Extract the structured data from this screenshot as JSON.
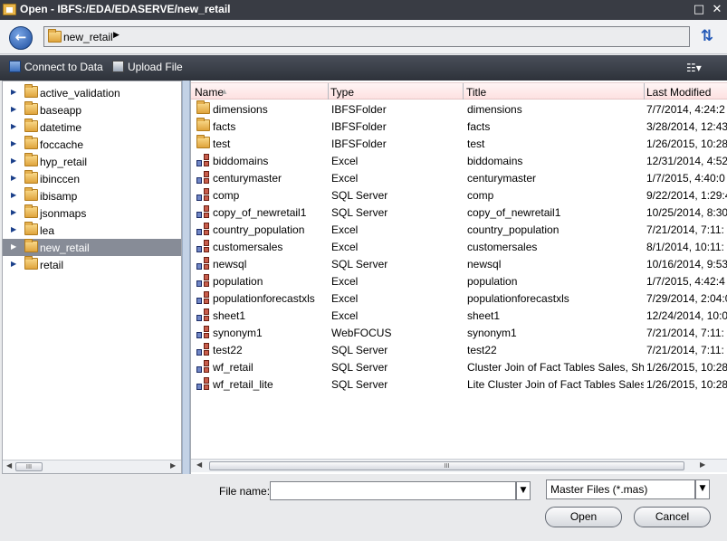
{
  "window": {
    "title": "Open - IBFS:/EDA/EDASERVE/new_retail",
    "maximize_glyph": "□",
    "close_glyph": "✕"
  },
  "nav": {
    "back_glyph": "←",
    "path_label": "new_retail",
    "path_arrow": "▶",
    "refresh_glyph": "⇅"
  },
  "toolbar": {
    "connect_label": "Connect to Data",
    "upload_label": "Upload File",
    "view_glyph": "☷▾"
  },
  "tree": {
    "expand_glyph": "▶",
    "items": [
      {
        "label": "active_validation"
      },
      {
        "label": "baseapp"
      },
      {
        "label": "datetime"
      },
      {
        "label": "foccache"
      },
      {
        "label": "hyp_retail"
      },
      {
        "label": "ibinccen"
      },
      {
        "label": "ibisamp"
      },
      {
        "label": "jsonmaps"
      },
      {
        "label": "lea"
      },
      {
        "label": "new_retail",
        "selected": true
      },
      {
        "label": "retail"
      }
    ]
  },
  "list": {
    "columns": {
      "name": "Name",
      "type": "Type",
      "title": "Title",
      "modified": "Last Modified"
    },
    "sort_glyph": "▲",
    "rows": [
      {
        "icon": "folder",
        "name": "dimensions",
        "type": "IBFSFolder",
        "title": "dimensions",
        "modified": "7/7/2014, 4:24:2"
      },
      {
        "icon": "folder",
        "name": "facts",
        "type": "IBFSFolder",
        "title": "facts",
        "modified": "3/28/2014, 12:43"
      },
      {
        "icon": "folder",
        "name": "test",
        "type": "IBFSFolder",
        "title": "test",
        "modified": "1/26/2015, 10:28"
      },
      {
        "icon": "synonym",
        "name": "biddomains",
        "type": "Excel",
        "title": "biddomains",
        "modified": "12/31/2014, 4:52"
      },
      {
        "icon": "synonym",
        "name": "centurymaster",
        "type": "Excel",
        "title": "centurymaster",
        "modified": "1/7/2015, 4:40:0"
      },
      {
        "icon": "synonym",
        "name": "comp",
        "type": "SQL Server",
        "title": "comp",
        "modified": "9/22/2014, 1:29:4"
      },
      {
        "icon": "synonym",
        "name": "copy_of_newretail1",
        "type": "SQL Server",
        "title": "copy_of_newretail1",
        "modified": "10/25/2014, 8:30"
      },
      {
        "icon": "synonym",
        "name": "country_population",
        "type": "Excel",
        "title": "country_population",
        "modified": "7/21/2014, 7:11:"
      },
      {
        "icon": "synonym",
        "name": "customersales",
        "type": "Excel",
        "title": "customersales",
        "modified": "8/1/2014, 10:11:"
      },
      {
        "icon": "synonym",
        "name": "newsql",
        "type": "SQL Server",
        "title": "newsql",
        "modified": "10/16/2014, 9:53"
      },
      {
        "icon": "synonym",
        "name": "population",
        "type": "Excel",
        "title": "population",
        "modified": "1/7/2015, 4:42:4"
      },
      {
        "icon": "synonym",
        "name": "populationforecastxls",
        "type": "Excel",
        "title": "populationforecastxls",
        "modified": "7/29/2014, 2:04:0"
      },
      {
        "icon": "synonym",
        "name": "sheet1",
        "type": "Excel",
        "title": "sheet1",
        "modified": "12/24/2014, 10:0"
      },
      {
        "icon": "synonym",
        "name": "synonym1",
        "type": "WebFOCUS",
        "title": "synonym1",
        "modified": "7/21/2014, 7:11:"
      },
      {
        "icon": "synonym",
        "name": "test22",
        "type": "SQL Server",
        "title": "test22",
        "modified": "7/21/2014, 7:11:"
      },
      {
        "icon": "synonym",
        "name": "wf_retail",
        "type": "SQL Server",
        "title": "Cluster Join of Fact Tables Sales, Shipme",
        "modified": "1/26/2015, 10:28"
      },
      {
        "icon": "synonym",
        "name": "wf_retail_lite",
        "type": "SQL Server",
        "title": "Lite Cluster Join of Fact Tables Sales and",
        "modified": "1/26/2015, 10:28"
      }
    ]
  },
  "scroll": {
    "left_glyph": "◀",
    "right_glyph": "▶",
    "thumb_glyph": "III"
  },
  "footer": {
    "file_name_label": "File name:",
    "file_name_value": "",
    "dropdown_glyph": "▼",
    "filter_value": "Master Files (*.mas)",
    "open_label": "Open",
    "cancel_label": "Cancel"
  }
}
